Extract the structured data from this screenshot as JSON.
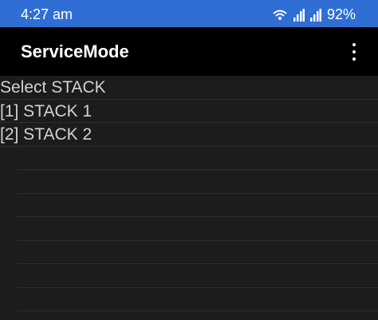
{
  "status_bar": {
    "time": "4:27 am",
    "battery": "92%",
    "accent": "#2f6fd3"
  },
  "app_bar": {
    "title": "ServiceMode",
    "menu_icon": "more-vert-icon"
  },
  "list": {
    "header": "Select STACK",
    "items": [
      "[1] STACK 1",
      "[2] STACK 2"
    ]
  }
}
